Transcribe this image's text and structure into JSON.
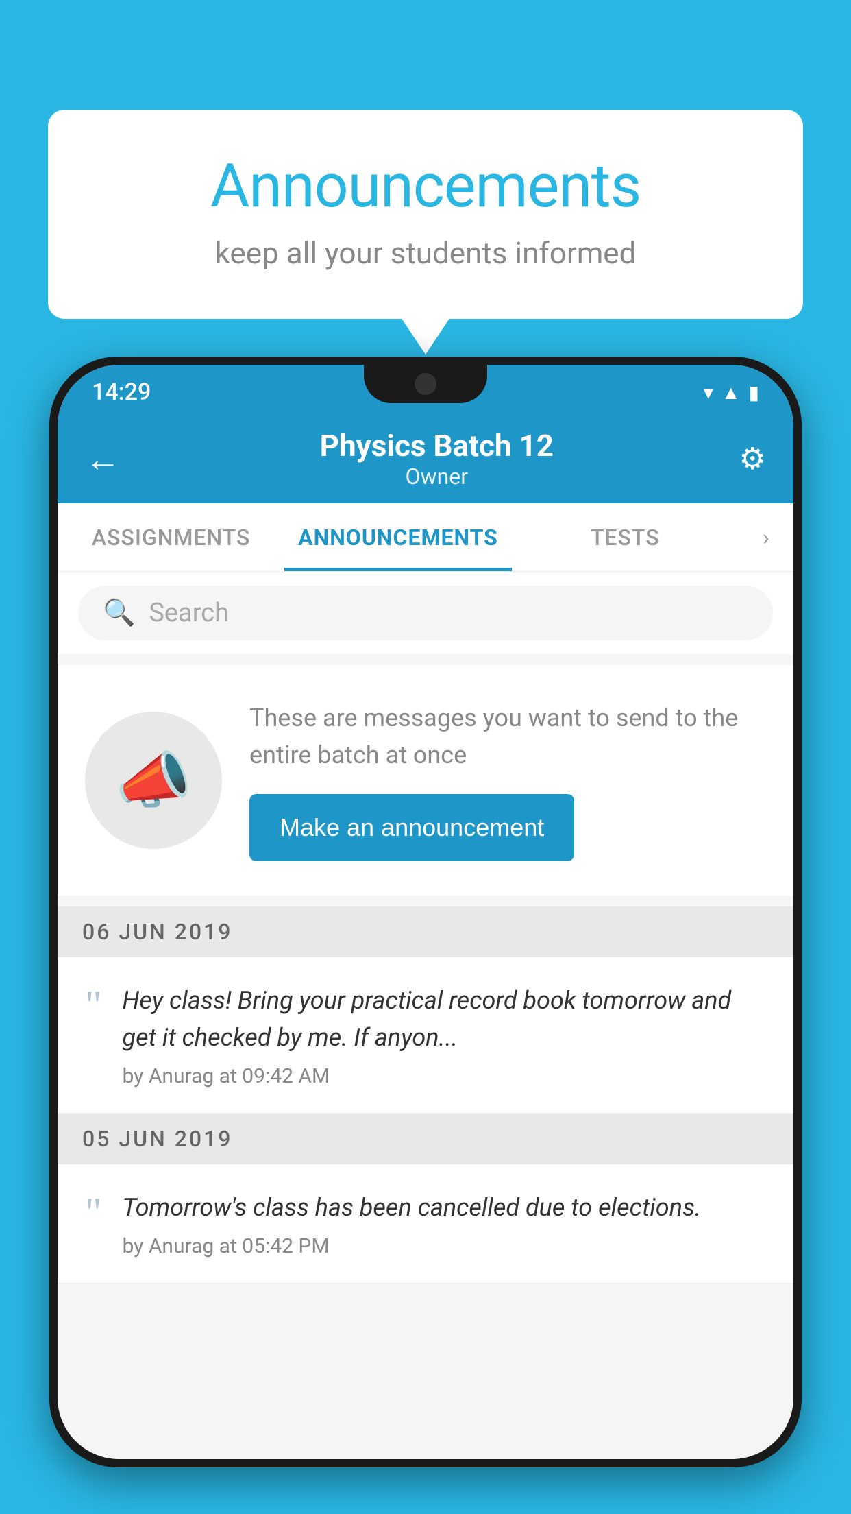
{
  "background_color": "#29b6e3",
  "speech_bubble": {
    "title": "Announcements",
    "subtitle": "keep all your students informed"
  },
  "status_bar": {
    "time": "14:29",
    "icons": [
      "wifi",
      "signal",
      "battery"
    ]
  },
  "app_bar": {
    "title": "Physics Batch 12",
    "subtitle": "Owner",
    "back_label": "←",
    "settings_label": "⚙"
  },
  "tabs": [
    {
      "label": "ASSIGNMENTS",
      "active": false
    },
    {
      "label": "ANNOUNCEMENTS",
      "active": true
    },
    {
      "label": "TESTS",
      "active": false
    }
  ],
  "search": {
    "placeholder": "Search"
  },
  "announcement_prompt": {
    "description_text": "These are messages you want to send to the entire batch at once",
    "button_label": "Make an announcement"
  },
  "date_groups": [
    {
      "date": "06  JUN  2019",
      "announcements": [
        {
          "text": "Hey class! Bring your practical record book tomorrow and get it checked by me. If anyon...",
          "meta": "by Anurag at 09:42 AM"
        }
      ]
    },
    {
      "date": "05  JUN  2019",
      "announcements": [
        {
          "text": "Tomorrow's class has been cancelled due to elections.",
          "meta": "by Anurag at 05:42 PM"
        }
      ]
    }
  ]
}
